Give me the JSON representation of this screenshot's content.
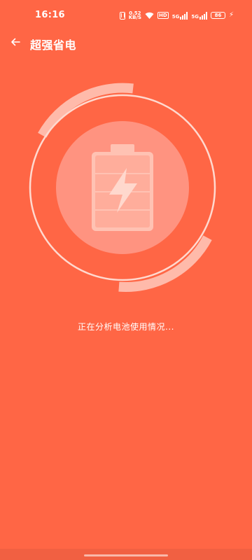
{
  "status_bar": {
    "time": "16:16",
    "net_speed_value": "0.52",
    "net_speed_unit": "KB/S",
    "hd_label": "HD",
    "signal1_label": "5G",
    "signal2_label": "5G",
    "battery_level": "86"
  },
  "header": {
    "title": "超强省电",
    "back_icon": "arrow-left-icon"
  },
  "main": {
    "status_text": "正在分析电池使用情况...",
    "battery_icon": "battery-charging-icon"
  },
  "colors": {
    "background": "#FF6645",
    "ring": "#FFD3C7",
    "inner_circle": "#FF9380"
  }
}
